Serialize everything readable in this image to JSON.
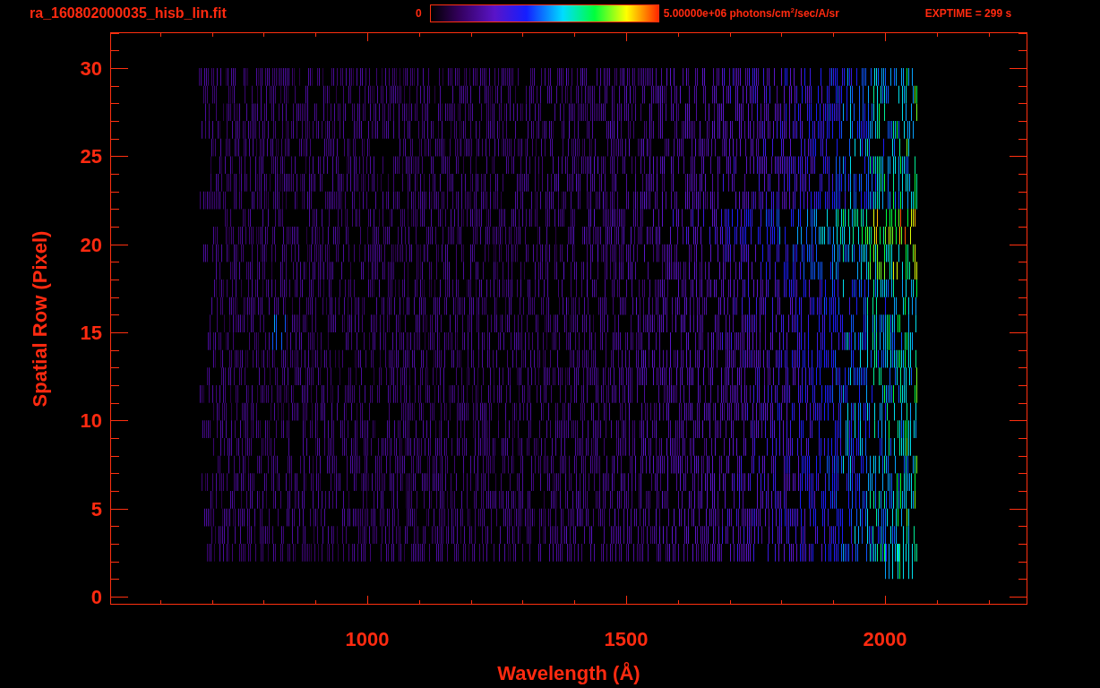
{
  "header": {
    "file_name": "ra_160802000035_hisb_lin.fit",
    "colorbar": {
      "min_label": "0",
      "max_label": "5.00000e+06 photons/cm$^{2}$/sec/A/sr"
    },
    "exposure": "EXPTIME = 299 s"
  },
  "plot": {
    "x_axis": {
      "label": "Wavelength (Å)",
      "tick_labels": [
        "1000",
        "1500",
        "2000"
      ]
    },
    "y_axis": {
      "label": "Spatial Row (Pixel)",
      "tick_labels": [
        "30",
        "25",
        "20",
        "15",
        "10",
        "5",
        "0"
      ]
    }
  }
}
